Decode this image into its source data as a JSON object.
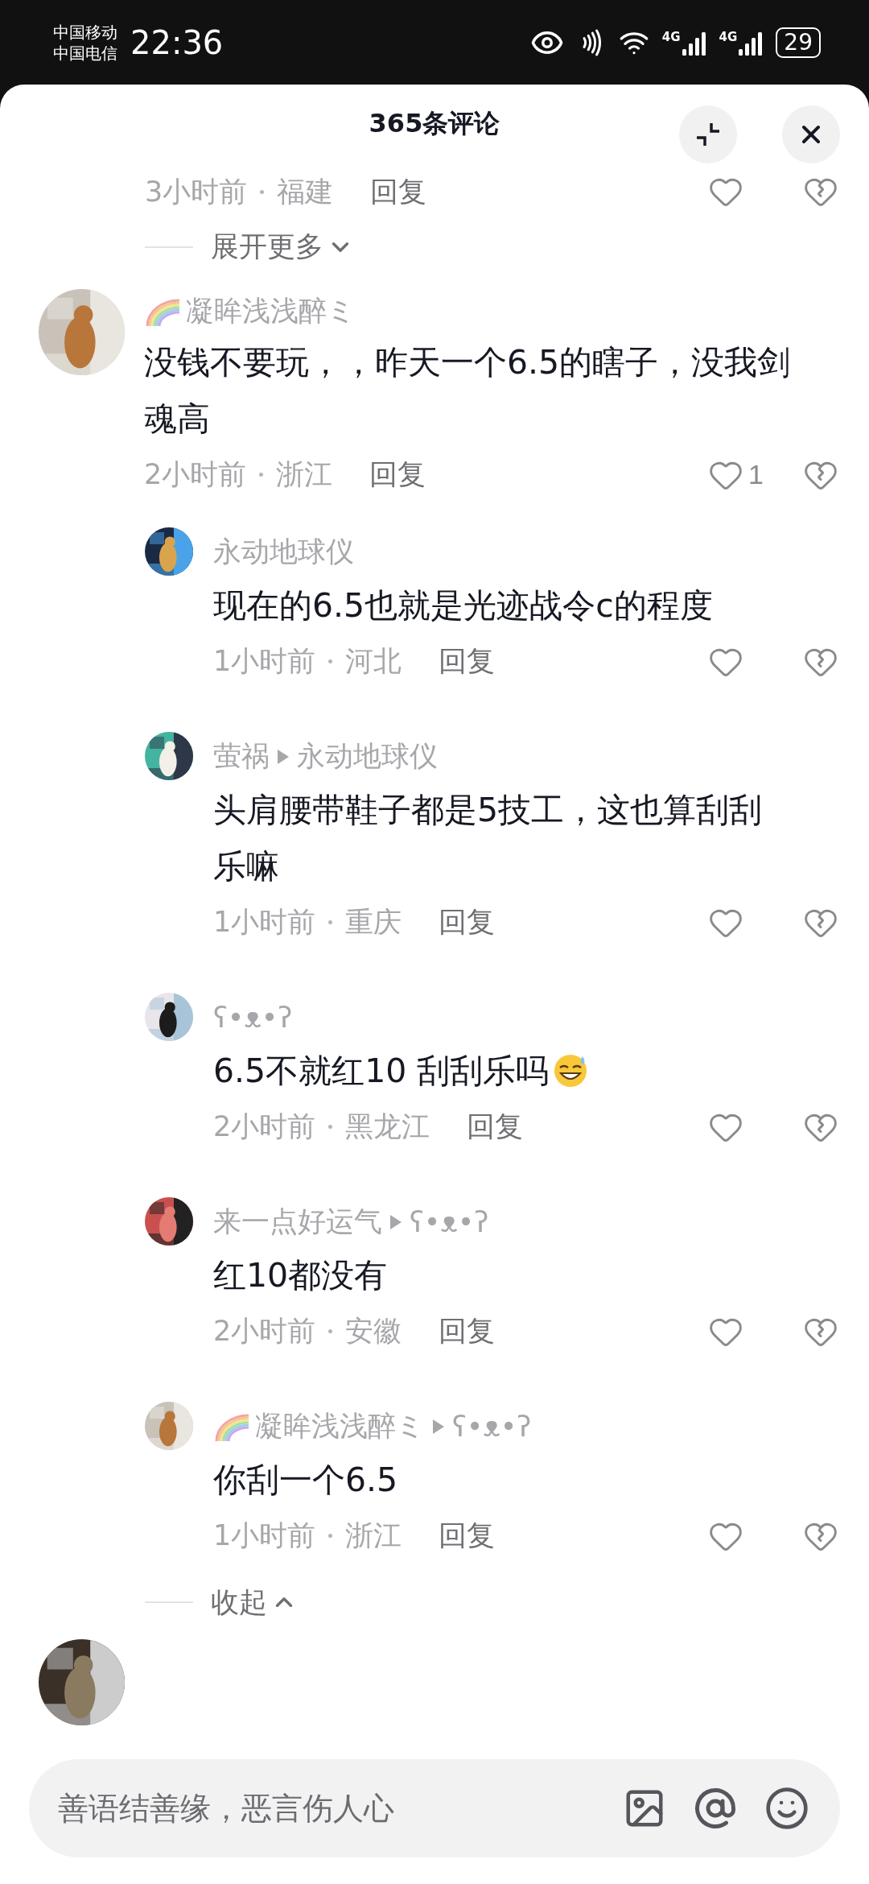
{
  "status_bar": {
    "carriers": [
      "中国移动",
      "中国电信"
    ],
    "time": "22:36",
    "network_labels": [
      "4G",
      "4G"
    ],
    "battery": "29"
  },
  "header": {
    "title": "365条评论"
  },
  "previous_meta": {
    "time": "3小时前",
    "location": "福建",
    "reply": "回复"
  },
  "expand_more": {
    "label": "展开更多"
  },
  "comment": {
    "author": {
      "name": "凝眸浅浅醉ミ",
      "rainbow": true
    },
    "text": "没钱不要玩，，昨天一个6.5的瞎子，没我剑魂高",
    "time": "2小时前",
    "location": "浙江",
    "reply": "回复",
    "likes": "1"
  },
  "replies": [
    {
      "author": {
        "name": "永动地球仪",
        "rainbow": false
      },
      "text": "现在的6.5也就是光迹战令c的程度",
      "time": "1小时前",
      "location": "河北",
      "reply": "回复"
    },
    {
      "author": {
        "name": "萤祸",
        "rainbow": false
      },
      "reply_to": "永动地球仪",
      "text": "头肩腰带鞋子都是5技工，这也算刮刮乐嘛",
      "time": "1小时前",
      "location": "重庆",
      "reply": "回复"
    },
    {
      "author": {
        "name": "ʕ•ᴥ•ʔ",
        "rainbow": false
      },
      "text": "6.5不就红10 刮刮乐吗",
      "ends_with_emoji": true,
      "time": "2小时前",
      "location": "黑龙江",
      "reply": "回复"
    },
    {
      "author": {
        "name": "来一点好运气",
        "rainbow": false
      },
      "reply_to": "ʕ•ᴥ•ʔ",
      "text": "红10都没有",
      "time": "2小时前",
      "location": "安徽",
      "reply": "回复"
    },
    {
      "author": {
        "name": "凝眸浅浅醉ミ",
        "rainbow": true
      },
      "reply_to": "ʕ•ᴥ•ʔ",
      "text": "你刮一个6.5",
      "time": "1小时前",
      "location": "浙江",
      "reply": "回复"
    }
  ],
  "collapse": {
    "label": "收起"
  },
  "input": {
    "placeholder": "善语结善缘，恶言伤人心"
  }
}
